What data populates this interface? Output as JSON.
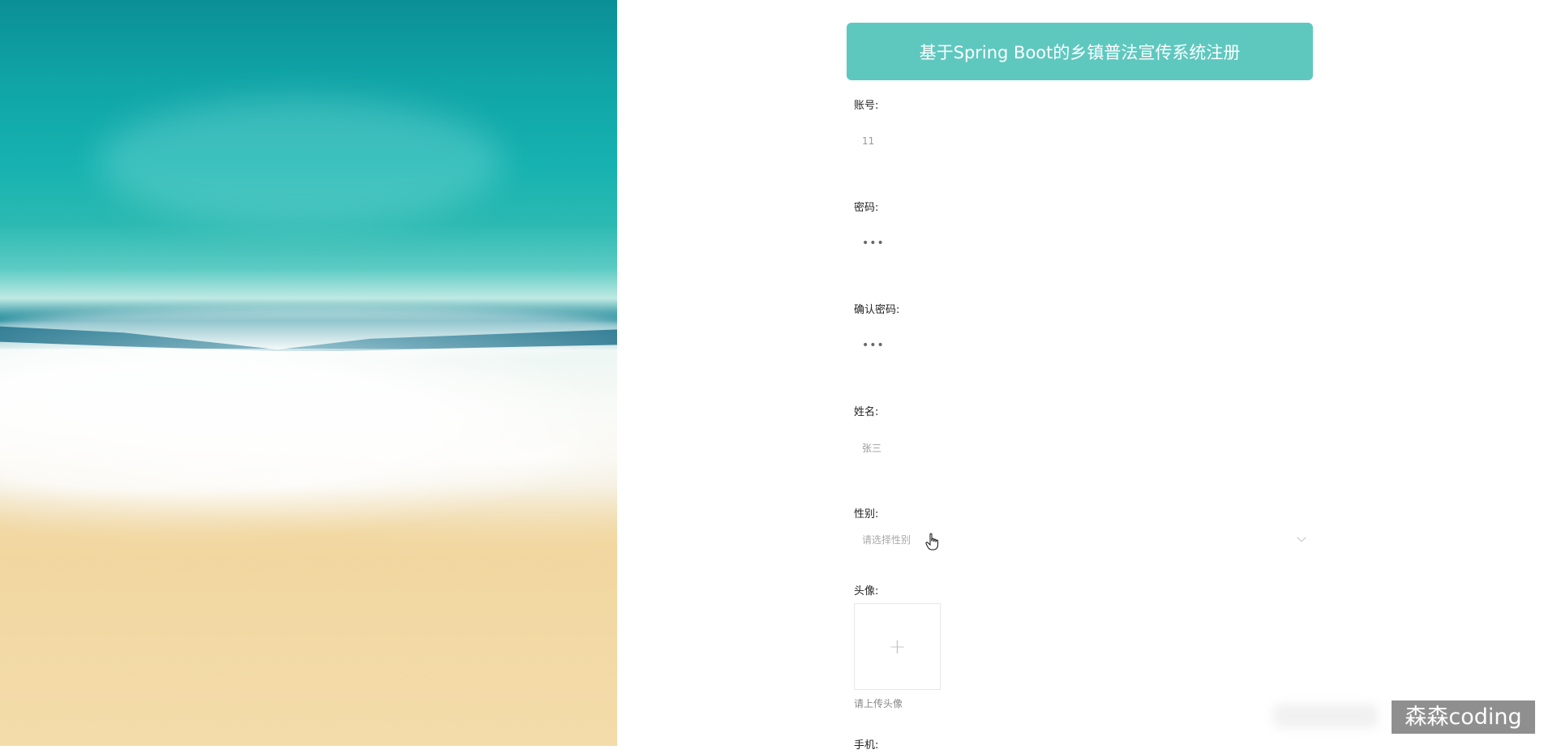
{
  "title": "基于Spring Boot的乡镇普法宣传系统注册",
  "fields": {
    "account": {
      "label": "账号:",
      "value": "11"
    },
    "password": {
      "label": "密码:",
      "value": "•••"
    },
    "confirm": {
      "label": "确认密码:",
      "value": "•••"
    },
    "name": {
      "label": "姓名:",
      "value": "张三"
    },
    "gender": {
      "label": "性别:",
      "placeholder": "请选择性别"
    },
    "avatar": {
      "label": "头像:",
      "upload_symbol": "+",
      "tip": "请上传头像"
    },
    "phone": {
      "label": "手机:"
    }
  },
  "watermark": "森森coding",
  "colors": {
    "title_bg": "#5ec8bf",
    "title_text": "#ffffff"
  },
  "icons": {
    "upload": "plus-icon",
    "dropdown": "chevron-down-icon",
    "cursor": "hand-pointer-icon"
  }
}
